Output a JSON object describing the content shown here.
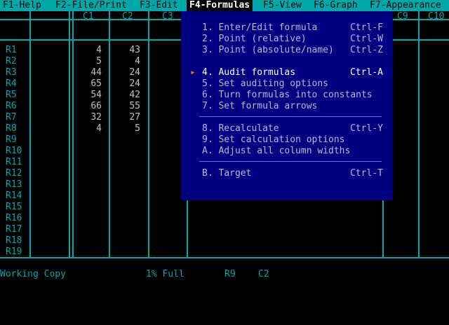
{
  "menubar": {
    "items": [
      {
        "label": "F1-Help"
      },
      {
        "label": "F2-File/Print"
      },
      {
        "label": "F3-Edit"
      },
      {
        "label": "F4-Formulas"
      },
      {
        "label": "F5-View"
      },
      {
        "label": "F6-Graph"
      },
      {
        "label": "F7-Appearance"
      }
    ],
    "active_index": 3
  },
  "sheet": {
    "columns": [
      "C1",
      "C2",
      "C3",
      "C9",
      "C10"
    ],
    "rows": [
      "R1",
      "R2",
      "R3",
      "R4",
      "R5",
      "R6",
      "R7",
      "R8",
      "R9",
      "R10",
      "R11",
      "R12",
      "R13",
      "R14",
      "R15",
      "R16",
      "R17",
      "R18",
      "R19"
    ],
    "c1": [
      "4",
      "5",
      "44",
      "65",
      "54",
      "66",
      "32",
      "4"
    ],
    "c2": [
      "43",
      "4",
      "24",
      "24",
      "42",
      "55",
      "27",
      "5"
    ]
  },
  "dropdown": {
    "items": [
      {
        "label": "1. Enter/Edit formula",
        "shortcut": "Ctrl-F"
      },
      {
        "label": "2. Point (relative)",
        "shortcut": "Ctrl-W"
      },
      {
        "label": "3. Point (absolute/name)",
        "shortcut": "Ctrl-Z"
      },
      {
        "label": "4. Audit formulas",
        "shortcut": "Ctrl-A"
      },
      {
        "label": "5. Set auditing options",
        "shortcut": ""
      },
      {
        "label": "6. Turn formulas into constants",
        "shortcut": ""
      },
      {
        "label": "7. Set formula arrows",
        "shortcut": ""
      },
      {
        "label": "8. Recalculate",
        "shortcut": "Ctrl-Y"
      },
      {
        "label": "9. Set calculation options",
        "shortcut": ""
      },
      {
        "label": "A. Adjust all column widths",
        "shortcut": ""
      },
      {
        "label": "B. Target",
        "shortcut": "Ctrl-T"
      }
    ],
    "selected_index": 3,
    "selection_marker": "▸"
  },
  "statusbar": {
    "mode": "Working Copy",
    "memory": "1% Full",
    "row": "R9",
    "col": "C2"
  },
  "colors": {
    "menubar_bg": "#00a8a8",
    "dropdown_bg": "#000080",
    "grid": "#00a8a8",
    "marker": "#e08020"
  }
}
